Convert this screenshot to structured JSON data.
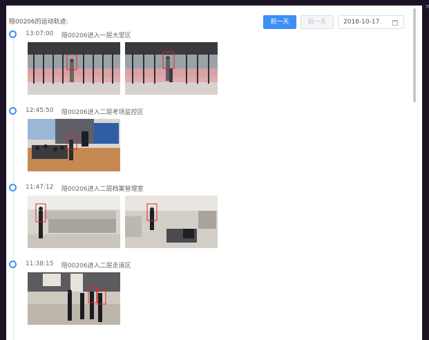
{
  "header": {
    "title": "陪00206的运动轨迹:",
    "prev_day_label": "前一天",
    "next_day_label": "后一天",
    "date_value": "2018-10-17"
  },
  "timeline": [
    {
      "time": "13:07:00",
      "description": "陪00206进入一层大堂区"
    },
    {
      "time": "12:45:50",
      "description": "陪00206进入二层考场监控区"
    },
    {
      "time": "11:47:12",
      "description": "陪00206进入二层档案管理室"
    },
    {
      "time": "11:38:15",
      "description": "陪00206进入二层走道区"
    }
  ],
  "colors": {
    "accent": "#3d8ef5",
    "detection_box": "#e0262c"
  },
  "icons": {
    "close": "close-icon",
    "calendar": "calendar-icon",
    "timeline_dot": "timeline-dot-icon"
  }
}
